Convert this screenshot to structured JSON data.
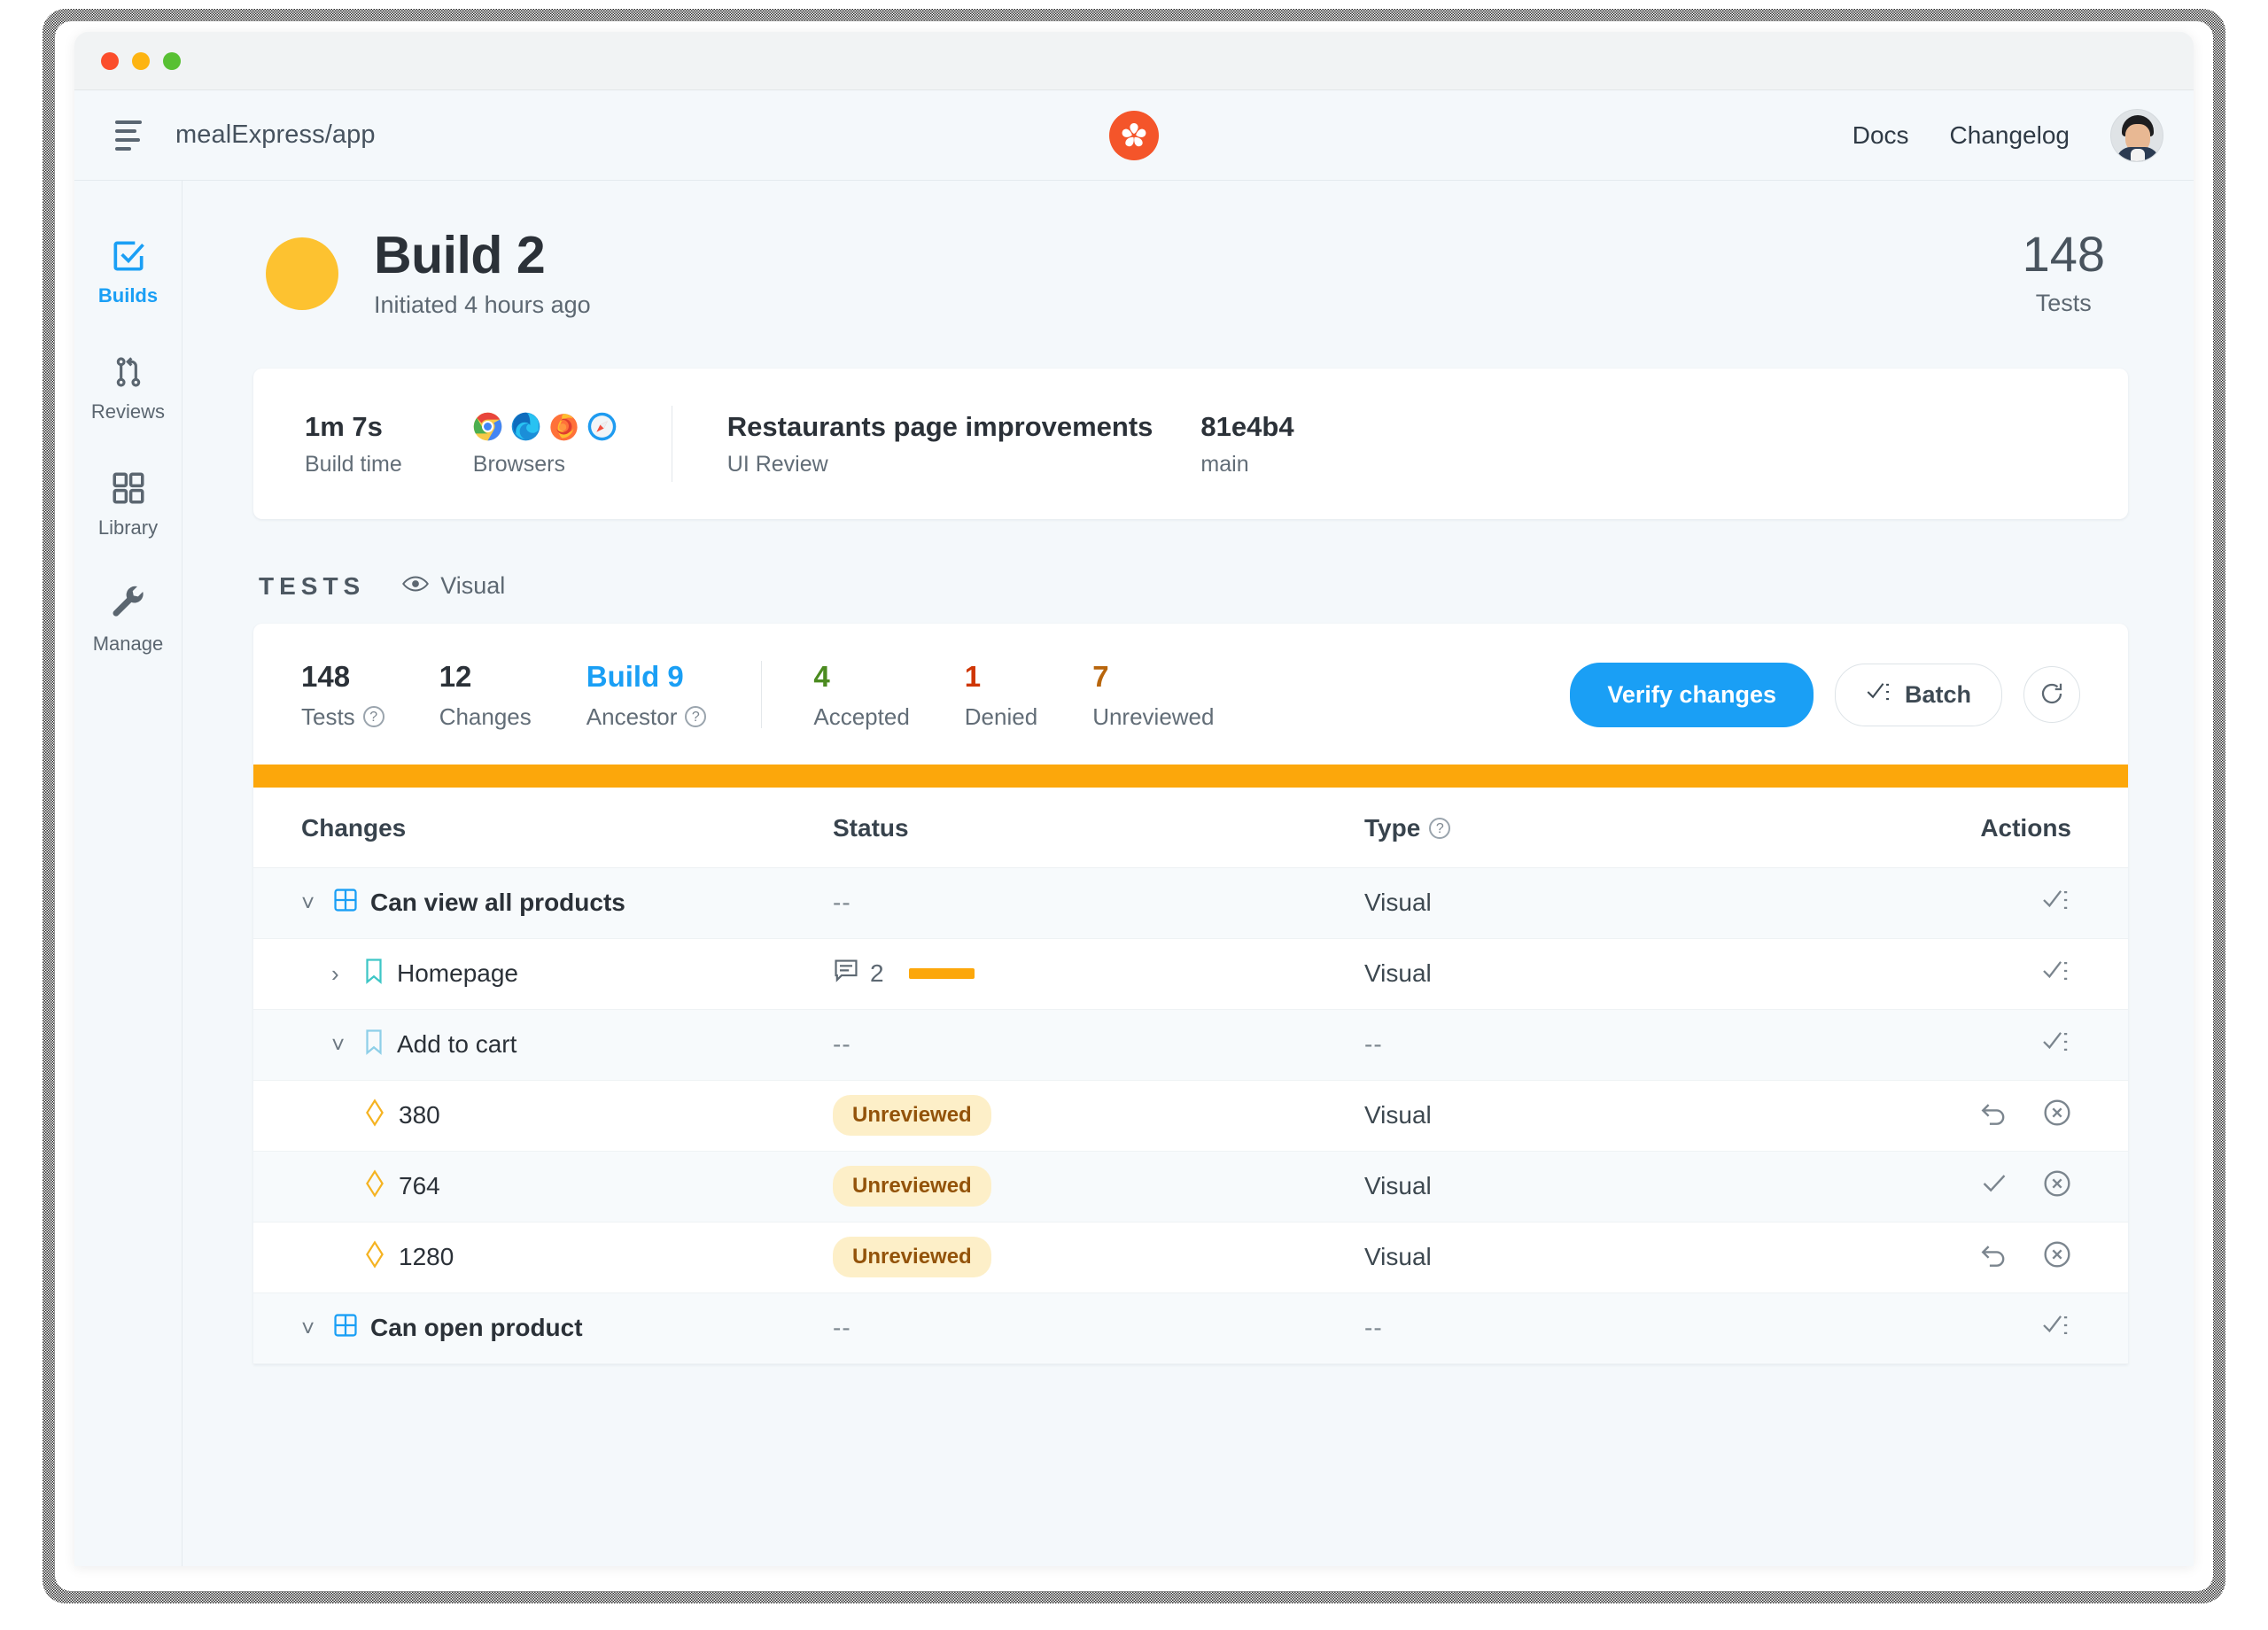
{
  "window": {
    "traffic_lights": [
      "close",
      "minimize",
      "maximize"
    ]
  },
  "header": {
    "project": "mealExpress/app",
    "menu_icon": "hamburger-icon",
    "logo": "percy-logo",
    "links": [
      {
        "label": "Docs"
      },
      {
        "label": "Changelog"
      }
    ],
    "avatar": "user-avatar"
  },
  "sidebar": {
    "items": [
      {
        "label": "Builds",
        "icon": "checkbox-check-icon",
        "active": true
      },
      {
        "label": "Reviews",
        "icon": "branch-merge-icon",
        "active": false
      },
      {
        "label": "Library",
        "icon": "grid-squares-icon",
        "active": false
      },
      {
        "label": "Manage",
        "icon": "wrench-icon",
        "active": false
      }
    ]
  },
  "build": {
    "status_color": "#fdc230",
    "title": "Build 2",
    "subtitle": "Initiated 4 hours ago",
    "tests_count": "148",
    "tests_label": "Tests"
  },
  "info_card": {
    "build_time_value": "1m 7s",
    "build_time_label": "Build time",
    "browsers_label": "Browsers",
    "browsers": [
      "chrome",
      "edge",
      "firefox",
      "safari"
    ],
    "pr_title": "Restaurants page improvements",
    "pr_subtitle": "UI Review",
    "commit_sha": "81e4b4",
    "branch": "main"
  },
  "tests_section": {
    "heading": "TESTS",
    "filter_label": "Visual",
    "filter_icon": "eye-icon"
  },
  "stats": {
    "items": [
      {
        "num": "148",
        "cap": "Tests",
        "tone": "dark",
        "help": true
      },
      {
        "num": "12",
        "cap": "Changes",
        "tone": "dark",
        "help": false
      },
      {
        "num": "Build 9",
        "cap": "Ancestor",
        "tone": "blue",
        "help": true
      },
      {
        "num": "4",
        "cap": "Accepted",
        "tone": "green",
        "help": false
      },
      {
        "num": "1",
        "cap": "Denied",
        "tone": "red",
        "help": false
      },
      {
        "num": "7",
        "cap": "Unreviewed",
        "tone": "amber",
        "help": false
      }
    ],
    "verify_label": "Verify changes",
    "batch_label": "Batch",
    "refresh_icon": "refresh-icon",
    "progress_color": "#fca70b"
  },
  "table": {
    "columns": [
      "Changes",
      "Status",
      "Type",
      "Actions"
    ],
    "type_help": true,
    "rows": [
      {
        "indent": 0,
        "chevron": "down",
        "icon": "grid-icon",
        "name": "Can view all products",
        "bold": true,
        "status_kind": "dash",
        "status": "--",
        "comments": null,
        "type": "Visual",
        "actions": [
          "check-list-icon"
        ],
        "alt": true
      },
      {
        "indent": 1,
        "chevron": "right",
        "icon": "bookmark-icon",
        "name": "Homepage",
        "bold": false,
        "status_kind": "bar",
        "status": "",
        "comments": "2",
        "type": "Visual",
        "actions": [
          "check-list-icon"
        ],
        "alt": false
      },
      {
        "indent": 1,
        "chevron": "down",
        "icon": "bookmark-icon",
        "name": "Add to cart",
        "bold": false,
        "status_kind": "dash",
        "status": "--",
        "comments": null,
        "type": "--",
        "actions": [
          "check-list-icon"
        ],
        "alt": true
      },
      {
        "indent": 2,
        "chevron": "none",
        "icon": "diamond-icon",
        "name": "380",
        "bold": false,
        "status_kind": "badge",
        "status": "Unreviewed",
        "comments": null,
        "type": "Visual",
        "actions": [
          "undo-icon",
          "deny-circle-icon"
        ],
        "alt": false
      },
      {
        "indent": 2,
        "chevron": "none",
        "icon": "diamond-icon",
        "name": "764",
        "bold": false,
        "status_kind": "badge",
        "status": "Unreviewed",
        "comments": null,
        "type": "Visual",
        "actions": [
          "check-icon",
          "deny-circle-icon"
        ],
        "alt": true
      },
      {
        "indent": 2,
        "chevron": "none",
        "icon": "diamond-icon",
        "name": "1280",
        "bold": false,
        "status_kind": "badge",
        "status": "Unreviewed",
        "comments": null,
        "type": "Visual",
        "actions": [
          "undo-icon",
          "deny-circle-icon"
        ],
        "alt": false
      },
      {
        "indent": 0,
        "chevron": "down",
        "icon": "grid-icon",
        "name": "Can open product",
        "bold": true,
        "status_kind": "dash",
        "status": "--",
        "comments": null,
        "type": "--",
        "actions": [
          "check-list-icon"
        ],
        "alt": true
      }
    ]
  },
  "colors": {
    "accent_blue": "#1a9ff5",
    "amber": "#fca70b",
    "build_yellow": "#fdc230",
    "green": "#4b8b20",
    "red": "#cf3605",
    "brand_orange": "#f4552a"
  }
}
